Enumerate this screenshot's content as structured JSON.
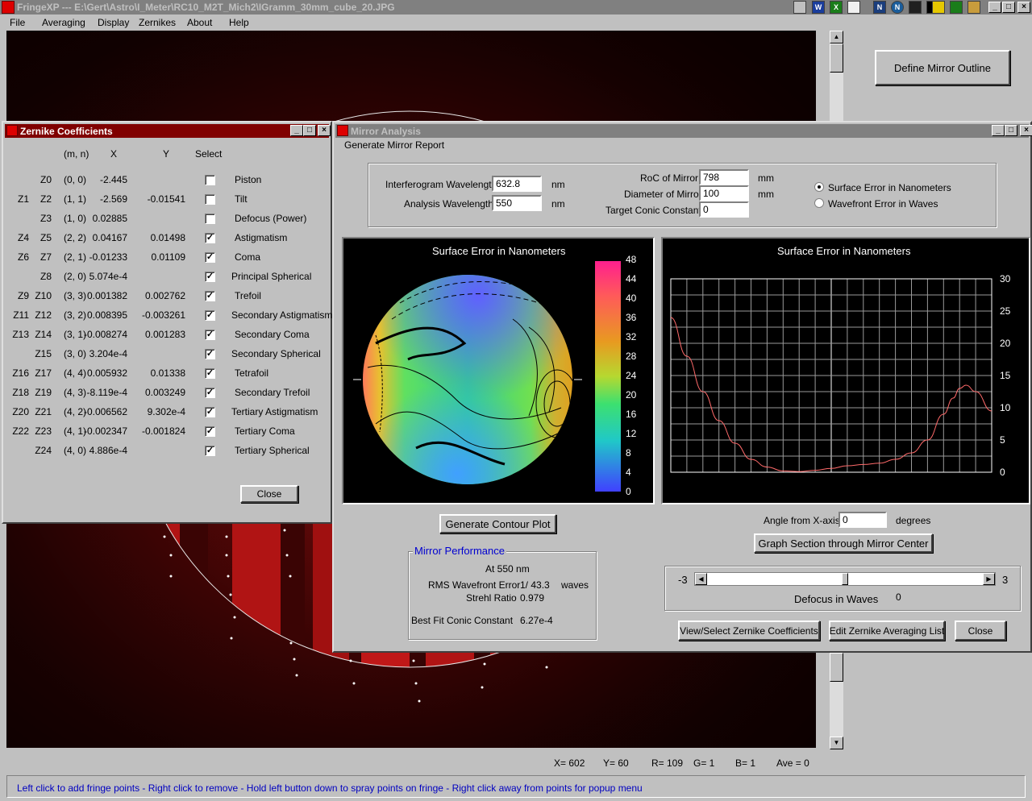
{
  "app": {
    "title": "FringeXP --- E:\\Gert\\Astro\\I_Meter\\RC10_M2T_Mich2\\IGramm_30mm_cube_20.JPG",
    "menu": [
      "File",
      "Averaging",
      "Display",
      "Zernikes",
      "About",
      "Help"
    ],
    "define_outline_label": "Define Mirror Outline"
  },
  "taskbar_icons": [
    "windows-icon",
    "word-icon",
    "excel-icon",
    "notepad-icon",
    "netscape-icon",
    "navigator-icon",
    "screenshot-icon",
    "terminal-icon",
    "sun-icon",
    "sky-icon",
    "paint-icon"
  ],
  "zernike": {
    "title": "Zernike Coefficients",
    "headers": {
      "mn": "(m, n)",
      "x": "X",
      "y": "Y",
      "select": "Select"
    },
    "rows": [
      {
        "z1": "",
        "z2": "Z0",
        "mn": "(0, 0)",
        "x": "-2.445",
        "y": "",
        "checked": false,
        "name": "Piston"
      },
      {
        "z1": "Z1",
        "z2": "Z2",
        "mn": "(1, 1)",
        "x": "-2.569",
        "y": "-0.01541",
        "checked": false,
        "name": "Tilt"
      },
      {
        "z1": "",
        "z2": "Z3",
        "mn": "(1, 0)",
        "x": "0.02885",
        "y": "",
        "checked": false,
        "name": "Defocus (Power)"
      },
      {
        "z1": "Z4",
        "z2": "Z5",
        "mn": "(2, 2)",
        "x": "0.04167",
        "y": "0.01498",
        "checked": true,
        "name": "Astigmatism"
      },
      {
        "z1": "Z6",
        "z2": "Z7",
        "mn": "(2, 1)",
        "x": "-0.01233",
        "y": "0.01109",
        "checked": true,
        "name": "Coma"
      },
      {
        "z1": "",
        "z2": "Z8",
        "mn": "(2, 0)",
        "x": "5.074e-4",
        "y": "",
        "checked": true,
        "name": "Principal Spherical"
      },
      {
        "z1": "Z9",
        "z2": "Z10",
        "mn": "(3, 3)",
        "x": "0.001382",
        "y": "0.002762",
        "checked": true,
        "name": "Trefoil"
      },
      {
        "z1": "Z11",
        "z2": "Z12",
        "mn": "(3, 2)",
        "x": "0.008395",
        "y": "-0.003261",
        "checked": true,
        "name": "Secondary Astigmatism"
      },
      {
        "z1": "Z13",
        "z2": "Z14",
        "mn": "(3, 1)",
        "x": "-0.008274",
        "y": "0.001283",
        "checked": true,
        "name": "Secondary Coma"
      },
      {
        "z1": "",
        "z2": "Z15",
        "mn": "(3, 0)",
        "x": "3.204e-4",
        "y": "",
        "checked": true,
        "name": "Secondary Spherical"
      },
      {
        "z1": "Z16",
        "z2": "Z17",
        "mn": "(4, 4)",
        "x": "0.005932",
        "y": "0.01338",
        "checked": true,
        "name": "Tetrafoil"
      },
      {
        "z1": "Z18",
        "z2": "Z19",
        "mn": "(4, 3)",
        "x": "-8.119e-4",
        "y": "0.003249",
        "checked": true,
        "name": "Secondary Trefoil"
      },
      {
        "z1": "Z20",
        "z2": "Z21",
        "mn": "(4, 2)",
        "x": "-0.006562",
        "y": "9.302e-4",
        "checked": true,
        "name": "Tertiary Astigmatism"
      },
      {
        "z1": "Z22",
        "z2": "Z23",
        "mn": "(4, 1)",
        "x": "-0.002347",
        "y": "-0.001824",
        "checked": true,
        "name": "Tertiary Coma"
      },
      {
        "z1": "",
        "z2": "Z24",
        "mn": "(4, 0)",
        "x": "4.886e-4",
        "y": "",
        "checked": true,
        "name": "Tertiary Spherical"
      }
    ],
    "close_label": "Close"
  },
  "analysis": {
    "title": "Mirror Analysis",
    "menu_item": "Generate Mirror Report",
    "params": {
      "igram_wl_label": "Interferogram Wavelength",
      "igram_wl": "632.8",
      "nm1": "nm",
      "analysis_wl_label": "Analysis Wavelength",
      "analysis_wl": "550",
      "nm2": "nm",
      "roc_label": "RoC of Mirror",
      "roc": "798",
      "mm1": "mm",
      "diam_label": "Diameter of Mirror",
      "diam": "100",
      "mm2": "mm",
      "conic_label": "Target Conic Constant",
      "conic": "0",
      "radio_surface": "Surface Error in Nanometers",
      "radio_wavefront": "Wavefront Error in Waves",
      "radio_selected": "surface"
    },
    "contour": {
      "title": "Surface Error in Nanometers",
      "scale": [
        "48",
        "44",
        "40",
        "36",
        "32",
        "28",
        "24",
        "20",
        "16",
        "12",
        "8",
        "4",
        "0"
      ]
    },
    "section": {
      "title": "Surface Error in Nanometers",
      "yticks": [
        "30",
        "25",
        "20",
        "15",
        "10",
        "5",
        "0"
      ]
    },
    "chart_data": {
      "type": "line",
      "title": "Surface Error in Nanometers",
      "ylim": [
        0,
        30
      ],
      "xlim": [
        0,
        100
      ],
      "grid": true,
      "series": [
        {
          "x": [
            0,
            5,
            10,
            15,
            20,
            25,
            30,
            35,
            40,
            45,
            50,
            55,
            60,
            65,
            70,
            75,
            80,
            85,
            88,
            90,
            92,
            95,
            100
          ],
          "values": [
            24,
            18,
            12.5,
            8,
            4.5,
            2,
            0.8,
            0.2,
            0.1,
            0.3,
            0.6,
            1,
            1.2,
            1.4,
            2,
            3,
            5,
            9,
            11.5,
            13,
            13.5,
            12.5,
            9.5
          ]
        }
      ]
    },
    "generate_contour_label": "Generate Contour Plot",
    "angle_label": "Angle from X-axis",
    "angle": "0",
    "degrees": "degrees",
    "graph_section_label": "Graph Section through Mirror Center",
    "performance": {
      "legend": "Mirror Performance",
      "at": "At 550 nm",
      "rms_label": "RMS Wavefront Error",
      "rms": "1/ 43.3",
      "waves": "waves",
      "strehl_label": "Strehl Ratio",
      "strehl": "0.979",
      "conic_label": "Best Fit Conic Constant",
      "conic": "6.27e-4"
    },
    "defocus": {
      "min": "-3",
      "max": "3",
      "label": "Defocus in Waves",
      "value": "0",
      "position": 0.5
    },
    "view_zernike_label": "View/Select Zernike Coefficients",
    "edit_averaging_label": "Edit Zernike Averaging List",
    "close_label": "Close"
  },
  "status": {
    "x": "X= 602",
    "y": "Y= 60",
    "r": "R= 109",
    "g": "G= 1",
    "b": "B= 1",
    "ave": "Ave = 0"
  },
  "hint": "Left click to add fringe points  -  Right click to remove  -  Hold left button down to spray points on fringe  -  Right click away from points for popup menu"
}
